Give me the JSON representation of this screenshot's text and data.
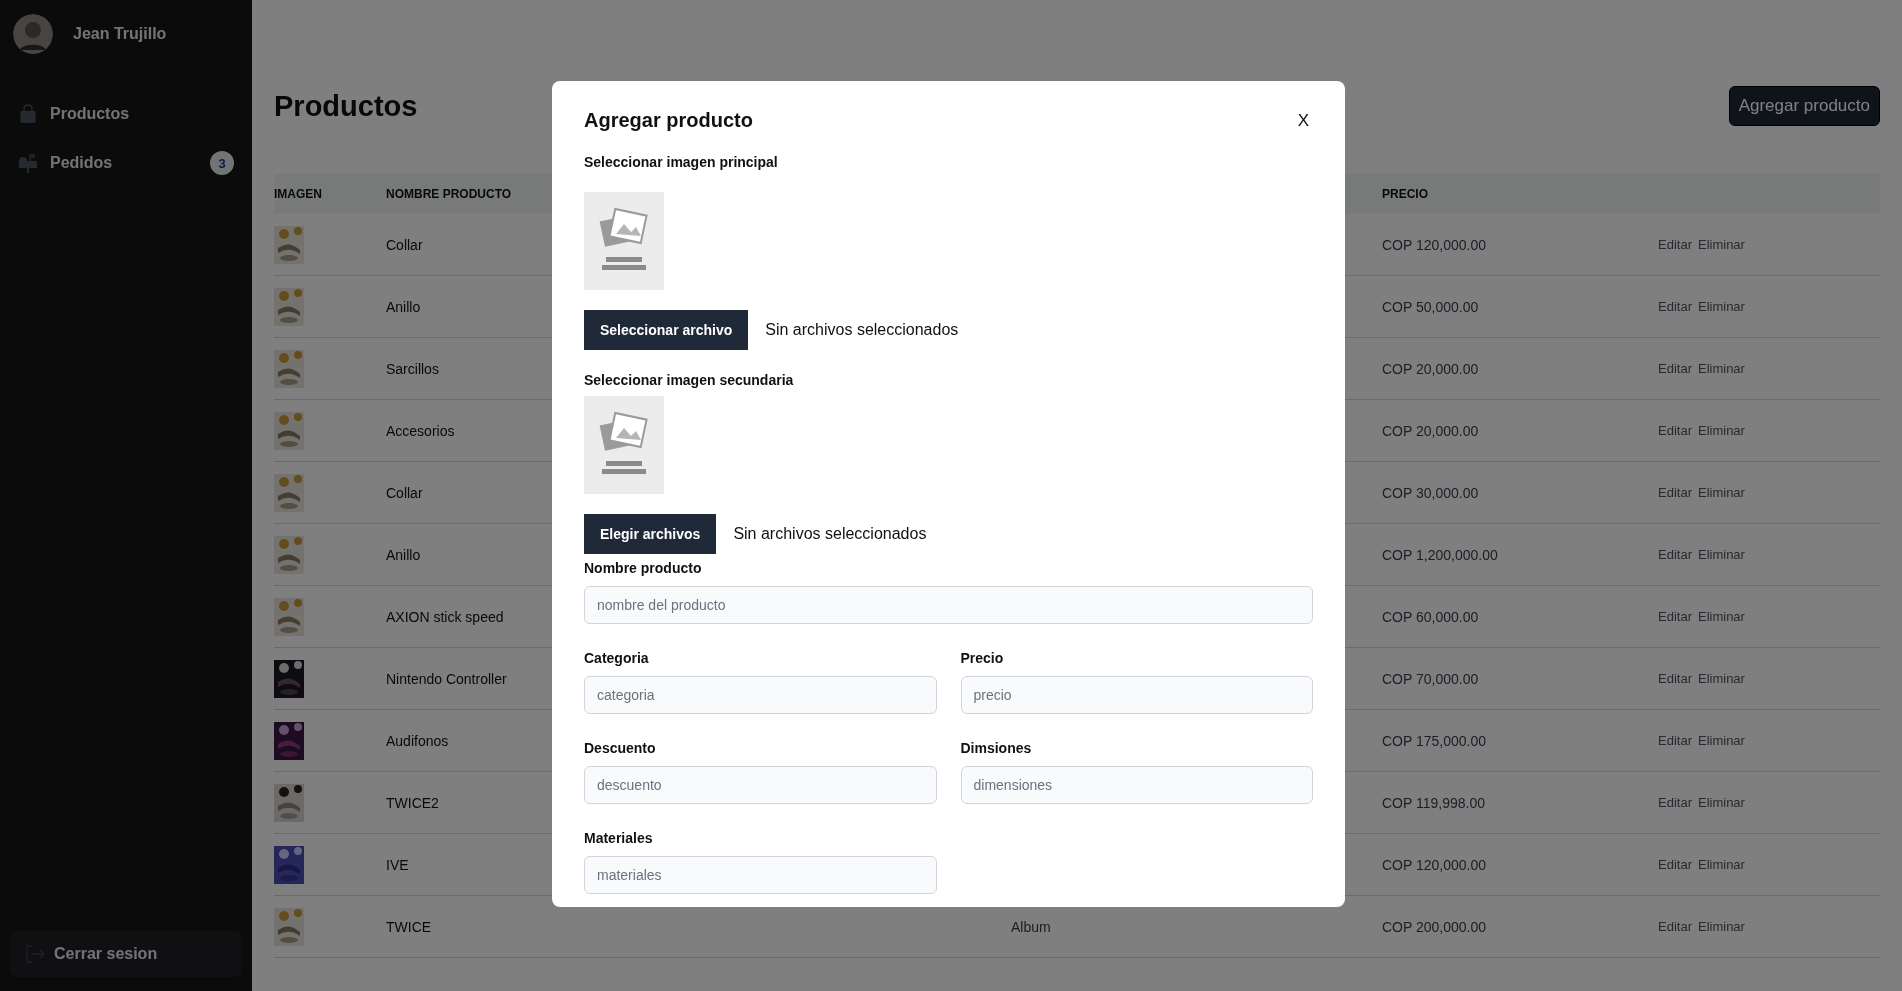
{
  "sidebar": {
    "user_name": "Jean Trujillo",
    "items": [
      {
        "kind": "bag",
        "label": "Productos"
      },
      {
        "kind": "mailbox",
        "label": "Pedidos",
        "badge": "3"
      }
    ],
    "logout": "Cerrar sesion"
  },
  "main": {
    "title": "Productos",
    "add_button": "Agregar producto",
    "table": {
      "header": {
        "image": "IMAGEN",
        "name": "NOMBRE PRODUCTO",
        "price": "PRECIO"
      },
      "rows": [
        {
          "name": "Collar",
          "price": "COP 120,000.00",
          "actions": [
            "Editar",
            "Eliminar"
          ]
        },
        {
          "name": "Anillo",
          "price": "COP 50,000.00",
          "actions": [
            "Editar",
            "Eliminar"
          ]
        },
        {
          "name": "Sarcillos",
          "price": "COP 20,000.00",
          "actions": [
            "Editar",
            "Eliminar"
          ]
        },
        {
          "name": "Accesorios",
          "price": "COP 20,000.00",
          "actions": [
            "Editar",
            "Eliminar"
          ]
        },
        {
          "name": "Collar",
          "price": "COP 30,000.00",
          "actions": [
            "Editar",
            "Eliminar"
          ]
        },
        {
          "name": "Anillo",
          "price": "COP 1,200,000.00",
          "actions": [
            "Editar",
            "Eliminar"
          ]
        },
        {
          "name": "AXION stick speed",
          "price": "COP 60,000.00",
          "actions": [
            "Editar",
            "Eliminar"
          ]
        },
        {
          "name": "Nintendo Controller",
          "price": "COP 70,000.00",
          "actions": [
            "Editar",
            "Eliminar"
          ]
        },
        {
          "name": "Audifonos",
          "price": "COP 175,000.00",
          "actions": [
            "Editar",
            "Eliminar"
          ]
        },
        {
          "name": "TWICE2",
          "price": "COP 119,998.00",
          "actions": [
            "Editar",
            "Eliminar"
          ]
        },
        {
          "name": "IVE",
          "price": "COP 120,000.00",
          "actions": [
            "Editar",
            "Eliminar"
          ]
        },
        {
          "name": "TWICE",
          "category": "Album",
          "price": "COP 200,000.00",
          "actions": [
            "Editar",
            "Eliminar"
          ]
        }
      ]
    }
  },
  "modal": {
    "title": "Agregar producto",
    "close": "X",
    "image_pickers": [
      {
        "label": "Seleccionar imagen principal",
        "button": "Seleccionar archivo",
        "status": "Sin archivos seleccionados"
      },
      {
        "label": "Seleccionar imagen secundaria",
        "button": "Elegir archivos",
        "status": "Sin archivos seleccionados"
      }
    ],
    "fields": [
      {
        "kind": "wide",
        "label": "Nombre producto",
        "placeholder": "nombre del producto"
      },
      {
        "kind": "half",
        "label": "Categoria",
        "placeholder": "categoria"
      },
      {
        "kind": "half",
        "label": "Precio",
        "placeholder": "precio"
      },
      {
        "kind": "half",
        "label": "Descuento",
        "placeholder": "descuento"
      },
      {
        "kind": "half",
        "label": "Dimsiones",
        "placeholder": "dimensiones"
      },
      {
        "kind": "half",
        "label": "Materiales",
        "placeholder": "materiales"
      }
    ]
  }
}
